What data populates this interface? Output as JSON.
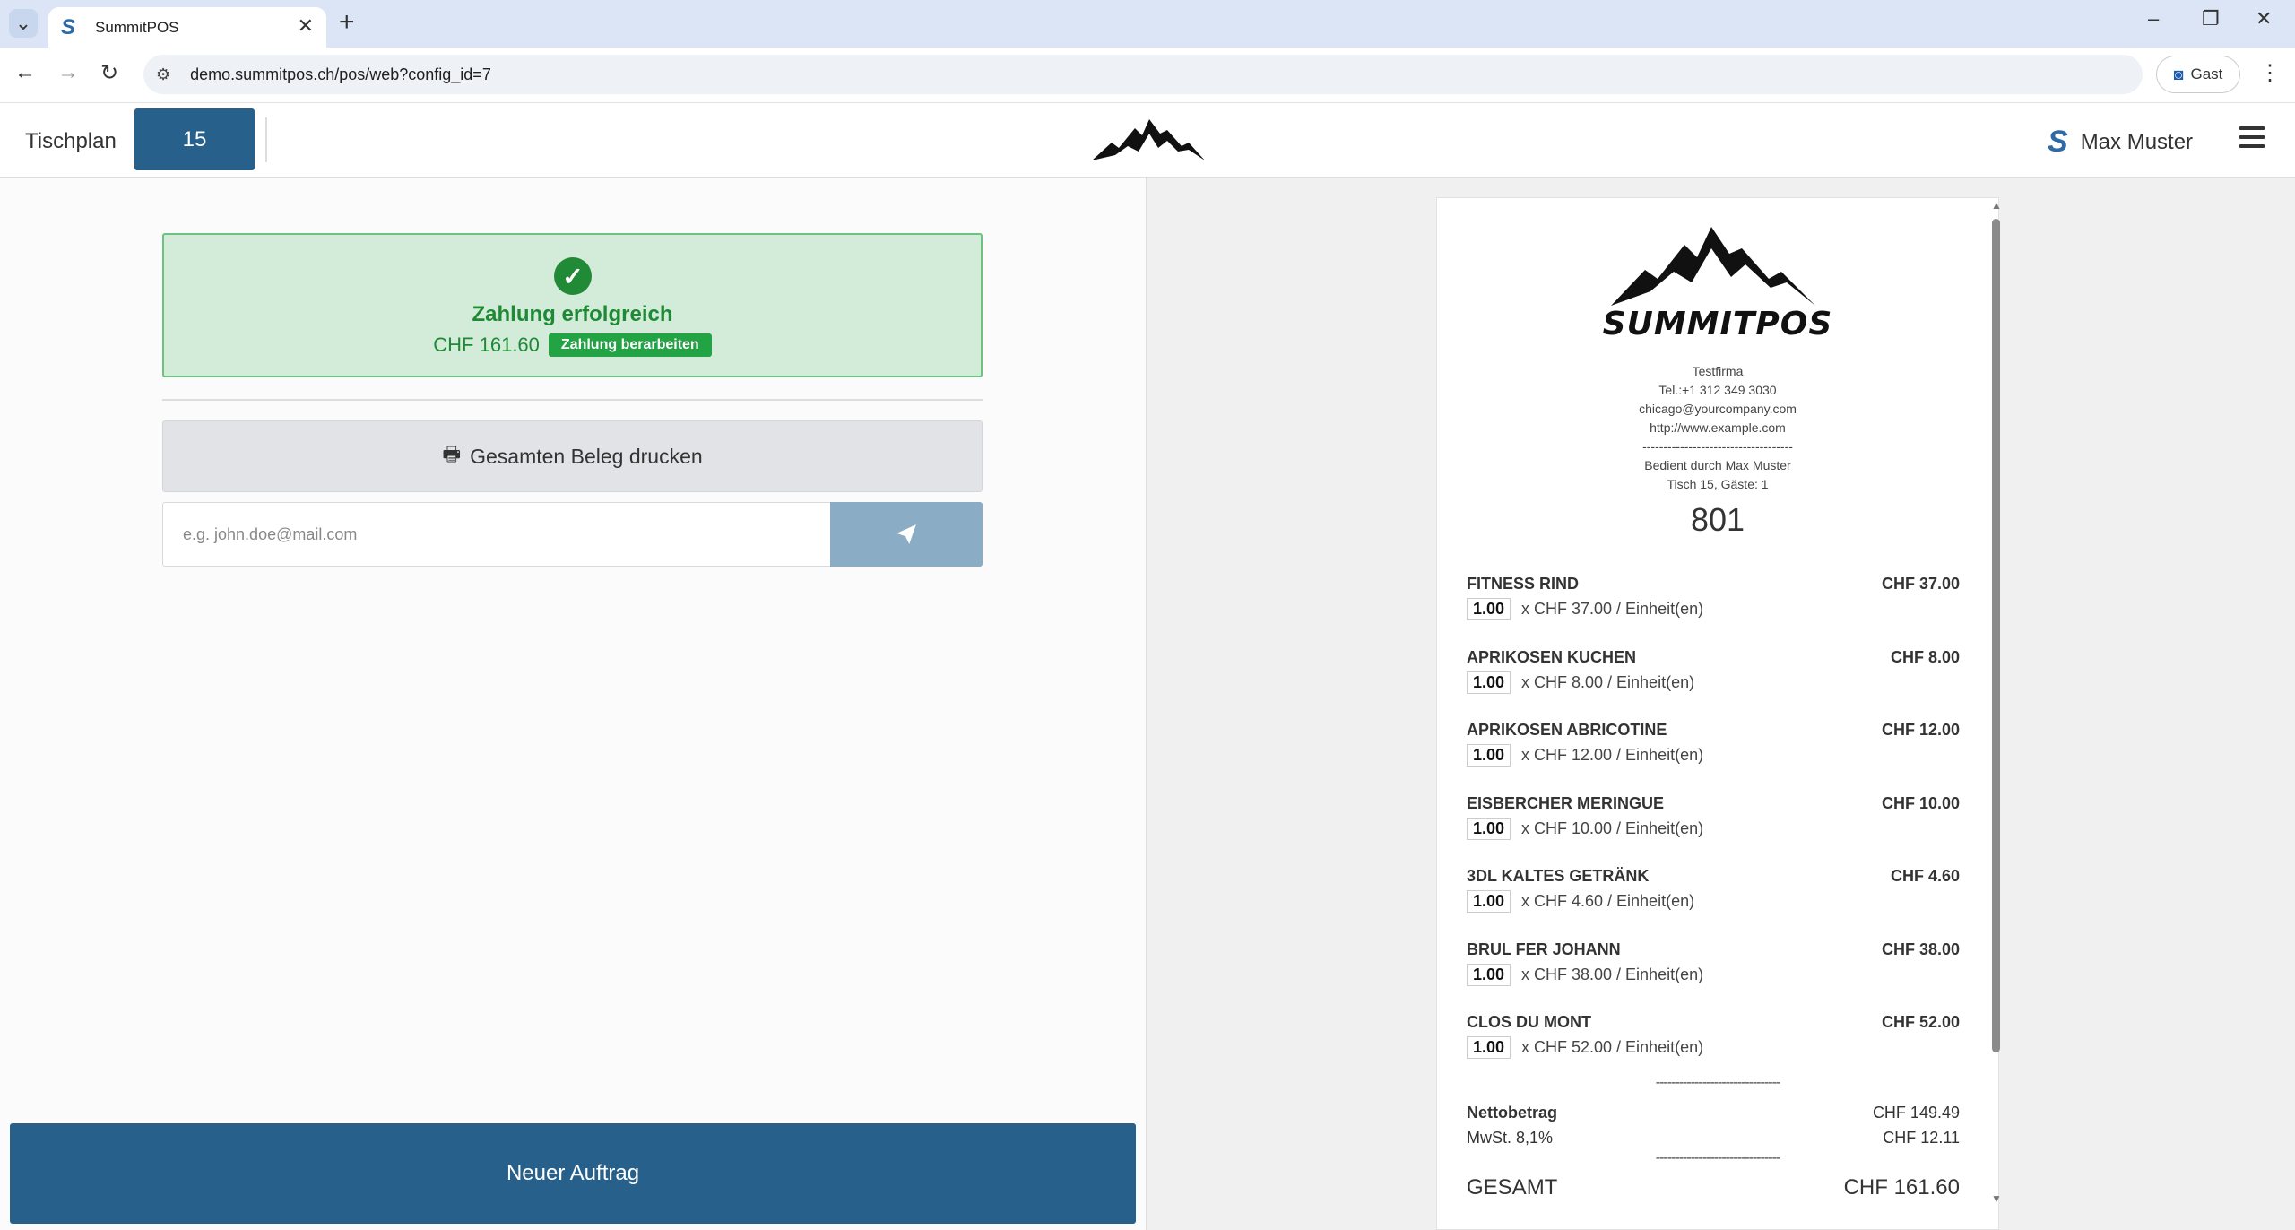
{
  "browser": {
    "tab_title": "SummitPOS",
    "url": "demo.summitpos.ch/pos/web?config_id=7",
    "profile_label": "Gast"
  },
  "header": {
    "floor_plan_label": "Tischplan",
    "table_number": "15",
    "user_name": "Max Muster"
  },
  "payment": {
    "status_title": "Zahlung erfolgreich",
    "amount": "CHF 161.60",
    "edit_badge": "Zahlung berarbeiten",
    "print_label": "Gesamten Beleg drucken",
    "email_placeholder": "e.g. john.doe@mail.com",
    "new_order_label": "Neuer Auftrag"
  },
  "receipt": {
    "brand": "SUMMITPOS",
    "company": "Testfirma",
    "phone": "Tel.:+1 312 349 3030",
    "email": "chicago@yourcompany.com",
    "website": "http://www.example.com",
    "separator": "------------------------------------",
    "served_by": "Bedient durch Max Muster",
    "table_info": "Tisch 15, Gäste: 1",
    "order_number": "801",
    "items": [
      {
        "name": "FITNESS RIND",
        "total": "CHF 37.00",
        "qty": "1.00",
        "detail": "x CHF 37.00 / Einheit(en)"
      },
      {
        "name": "APRIKOSEN KUCHEN",
        "total": "CHF 8.00",
        "qty": "1.00",
        "detail": "x CHF 8.00 / Einheit(en)"
      },
      {
        "name": "APRIKOSEN ABRICOTINE",
        "total": "CHF 12.00",
        "qty": "1.00",
        "detail": "x CHF 12.00 / Einheit(en)"
      },
      {
        "name": "EISBERCHER MERINGUE",
        "total": "CHF 10.00",
        "qty": "1.00",
        "detail": "x CHF 10.00 / Einheit(en)"
      },
      {
        "name": "3DL KALTES GETRÄNK",
        "total": "CHF 4.60",
        "qty": "1.00",
        "detail": "x CHF 4.60 / Einheit(en)"
      },
      {
        "name": "BRUL FER JOHANN",
        "total": "CHF 38.00",
        "qty": "1.00",
        "detail": "x CHF 38.00 / Einheit(en)"
      },
      {
        "name": "CLOS DU MONT",
        "total": "CHF 52.00",
        "qty": "1.00",
        "detail": "x CHF 52.00 / Einheit(en)"
      }
    ],
    "sum_separator": "--------------------------------",
    "net_label": "Nettobetrag",
    "net_value": "CHF 149.49",
    "vat_label": "MwSt. 8,1%",
    "vat_value": "CHF 12.11",
    "total_label": "GESAMT",
    "total_value": "CHF 161.60"
  },
  "colors": {
    "primary": "#27608a",
    "success_bg": "#d3ebd9",
    "success_text": "#1f8a35",
    "send_button": "#8aacc4"
  }
}
